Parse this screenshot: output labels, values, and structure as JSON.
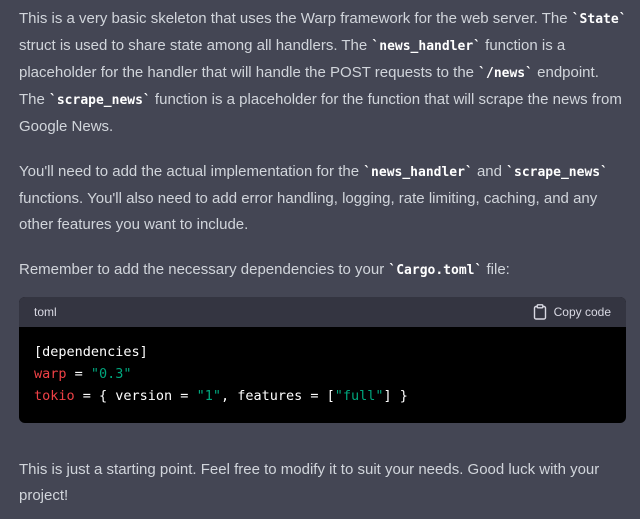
{
  "paragraph1": {
    "t1": "This is a very basic skeleton that uses the Warp framework for the web server. The ",
    "c1": "`State`",
    "t2": " struct is used to share state among all handlers. The ",
    "c2": "`news_handler`",
    "t3": " function is a placeholder for the handler that will handle the POST requests to the ",
    "c3": "`/news`",
    "t4": " endpoint. The ",
    "c4": "`scrape_news`",
    "t5": " function is a placeholder for the function that will scrape the news from Google News."
  },
  "paragraph2": {
    "t1": "You'll need to add the actual implementation for the ",
    "c1": "`news_handler`",
    "t2": " and ",
    "c2": "`scrape_news`",
    "t3": " functions. You'll also need to add error handling, logging, rate limiting, caching, and any other features you want to include."
  },
  "paragraph3": {
    "t1": "Remember to add the necessary dependencies to your ",
    "c1": "`Cargo.toml`",
    "t2": " file:"
  },
  "codeblock": {
    "language": "toml",
    "copy_label": "Copy code",
    "copy_icon": "clipboard-icon",
    "line1": "[dependencies]",
    "line2": {
      "key": "warp",
      "eq": " = ",
      "value": "\"0.3\""
    },
    "line3": {
      "key": "tokio",
      "p1": " = { version = ",
      "version": "\"1\"",
      "p2": ", features = [",
      "feature": "\"full\"",
      "p3": "] }"
    }
  },
  "closing": {
    "text": "This is just a starting point. Feel free to modify it to suit your needs. Good luck with your project!"
  },
  "colors": {
    "background": "#444654",
    "text": "#d1d5db",
    "code_background": "#000000",
    "code_header": "#343541",
    "toml_key": "#ef4146",
    "toml_string": "#00a67d"
  }
}
